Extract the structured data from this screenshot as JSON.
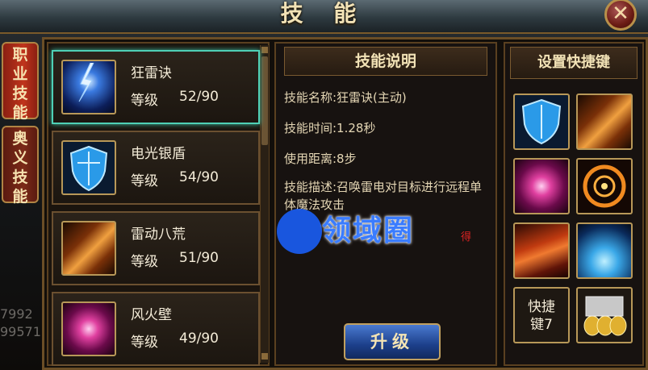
{
  "window": {
    "title": "技 能",
    "close_label": "✕"
  },
  "side_tabs": [
    {
      "label": "职业技能",
      "active": true
    },
    {
      "label": "奥义技能",
      "active": false
    }
  ],
  "side_numbers": [
    "7992",
    "99571"
  ],
  "skills": [
    {
      "name": "狂雷诀",
      "level_label": "等级",
      "level": "52/90",
      "icon": "lightning-icon",
      "selected": true
    },
    {
      "name": "电光银盾",
      "level_label": "等级",
      "level": "54/90",
      "icon": "shield-icon",
      "selected": false
    },
    {
      "name": "雷动八荒",
      "level_label": "等级",
      "level": "51/90",
      "icon": "fire-streak-icon",
      "selected": false
    },
    {
      "name": "风火壁",
      "level_label": "等级",
      "level": "49/90",
      "icon": "vortex-icon",
      "selected": false
    }
  ],
  "description": {
    "heading": "技能说明",
    "name_line": "技能名称:狂雷诀(主动)",
    "time_line": "技能时间:1.28秒",
    "range_line": "使用距离:8步",
    "desc_line": "技能描述:召唤雷电对目标进行远程单体魔法攻击",
    "partial_red": "得",
    "upgrade_label": "升级"
  },
  "quickkeys": {
    "heading": "设置快捷键",
    "slots": [
      {
        "icon": "shield-icon"
      },
      {
        "icon": "fire-streak-icon"
      },
      {
        "icon": "vortex-icon"
      },
      {
        "icon": "fire-ring-icon"
      },
      {
        "icon": "meteor-icon"
      },
      {
        "icon": "ice-burst-icon"
      },
      {
        "label": "快捷键7"
      },
      {
        "icon": "potion-stack-icon"
      }
    ]
  },
  "watermark": {
    "text": "领域圈"
  },
  "colors": {
    "accent_gold": "#b89858",
    "selected_teal": "#4fd0b6",
    "tab_red": "#c0341c",
    "button_blue": "#1c3f8a"
  }
}
